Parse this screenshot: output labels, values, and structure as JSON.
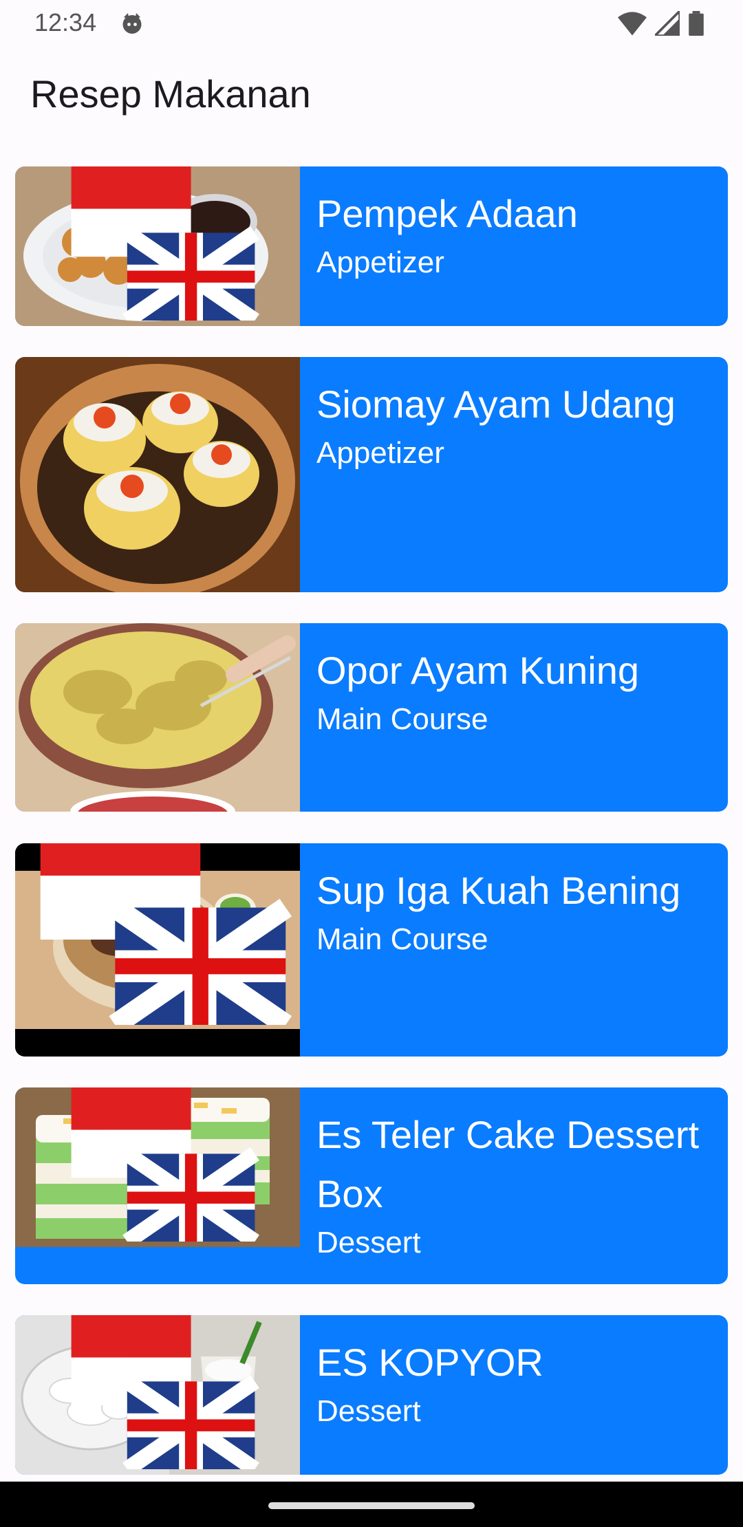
{
  "status": {
    "time": "12:34"
  },
  "app": {
    "title": "Resep Makanan"
  },
  "recipes": [
    {
      "title": "Pempek Adaan",
      "category": "Appetizer"
    },
    {
      "title": "Siomay Ayam Udang",
      "category": "Appetizer"
    },
    {
      "title": "Opor Ayam Kuning",
      "category": "Main Course"
    },
    {
      "title": "Sup Iga Kuah Bening",
      "category": "Main Course"
    },
    {
      "title": "Es Teler Cake Dessert Box",
      "category": "Dessert"
    },
    {
      "title": "ES KOPYOR",
      "category": "Dessert"
    }
  ],
  "colors": {
    "card": "#0a7cff",
    "background": "#fefbfe"
  }
}
